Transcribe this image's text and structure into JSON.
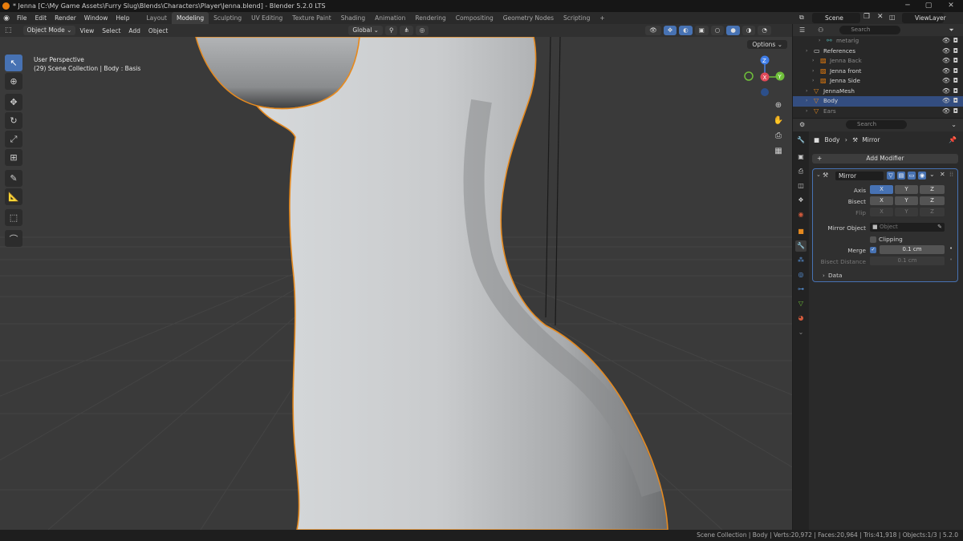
{
  "window": {
    "title": "* Jenna [C:\\My Game Assets\\Furry Slug\\Blends\\Characters\\Player\\Jenna.blend] - Blender 5.2.0 LTS"
  },
  "menu": [
    "File",
    "Edit",
    "Render",
    "Window",
    "Help"
  ],
  "workspaces": [
    "Layout",
    "Modeling",
    "Sculpting",
    "UV Editing",
    "Texture Paint",
    "Shading",
    "Animation",
    "Rendering",
    "Compositing",
    "Geometry Nodes",
    "Scripting"
  ],
  "active_workspace": "Modeling",
  "scene": "Scene",
  "view_layer": "ViewLayer",
  "viewport_header": {
    "mode": "Object Mode",
    "view": "View",
    "select": "Select",
    "add": "Add",
    "object": "Object",
    "transform_orientation": "Global"
  },
  "viewport": {
    "perspective": "User Perspective",
    "collection_info": "(29) Scene Collection | Body : Basis",
    "options": "Options"
  },
  "gizmo": {
    "x": "X",
    "y": "Y",
    "z": "Z"
  },
  "outliner": {
    "search_placeholder": "Search",
    "items": [
      {
        "name": "metarig",
        "indent": 3,
        "dim": true,
        "icon": "armature-icon"
      },
      {
        "name": "References",
        "indent": 1,
        "icon": "collection-icon"
      },
      {
        "name": "Jenna Back",
        "indent": 2,
        "dim": true,
        "icon": "image-icon"
      },
      {
        "name": "Jenna front",
        "indent": 2,
        "icon": "image-icon"
      },
      {
        "name": "Jenna Side",
        "indent": 2,
        "icon": "image-icon"
      },
      {
        "name": "JennaMesh",
        "indent": 1,
        "icon": "mesh-icon"
      },
      {
        "name": "Body",
        "indent": 1,
        "selected": true,
        "icon": "mesh-icon"
      },
      {
        "name": "Ears",
        "indent": 1,
        "dim": true,
        "icon": "mesh-icon"
      }
    ]
  },
  "properties": {
    "search_placeholder": "Search",
    "breadcrumb_object": "Body",
    "breadcrumb_modifier": "Mirror",
    "add_modifier": "Add Modifier",
    "modifier_name": "Mirror",
    "axis_label": "Axis",
    "bisect_label": "Bisect",
    "flip_label": "Flip",
    "x": "X",
    "y": "Y",
    "z": "Z",
    "mirror_object_label": "Mirror Object",
    "mirror_object_placeholder": "Object",
    "clipping_label": "Clipping",
    "merge_label": "Merge",
    "merge_value": "0.1 cm",
    "bisect_distance_label": "Bisect Distance",
    "bisect_distance_value": "0.1 cm",
    "data_label": "Data"
  },
  "status": {
    "text": "Scene Collection | Body | Verts:20,972 | Faces:20,964 | Tris:41,918 | Objects:1/3 | 5.2.0"
  },
  "colors": {
    "accent": "#4772b3",
    "selection_orange": "#e68a1f",
    "viewport_bg": "#3a3a3a",
    "mesh": "#c4c7c9"
  }
}
